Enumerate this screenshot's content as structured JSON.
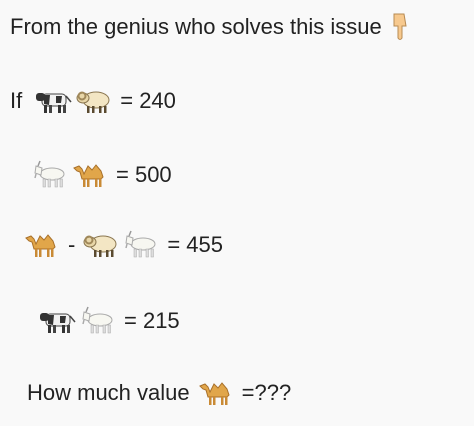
{
  "title": "From the genius who solves this issue",
  "icons": {
    "pointing": "pointing-down-hand-icon",
    "cow": "cow-icon",
    "ram": "ram-icon",
    "goat": "goat-icon",
    "camel": "camel-icon"
  },
  "equations": {
    "eq1": {
      "prefix": "If",
      "result": "= 240"
    },
    "eq2": {
      "result": "= 500"
    },
    "eq3": {
      "operator": "-",
      "result": "= 455"
    },
    "eq4": {
      "result": "= 215"
    }
  },
  "question": {
    "label": "How much value",
    "suffix": "=???"
  }
}
